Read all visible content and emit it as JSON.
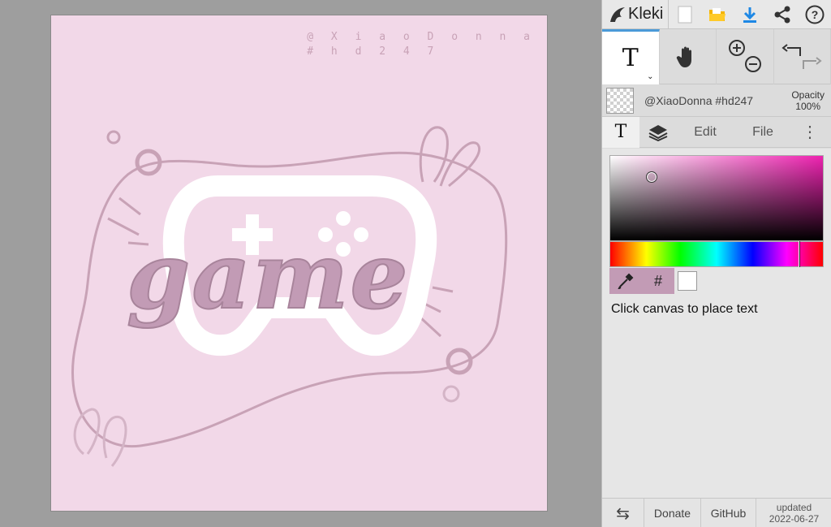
{
  "canvas": {
    "background_color": "#f2d8e8",
    "watermark_line1": "@ X i a o D o n n a",
    "watermark_line2": "# h d 2 4 7",
    "art_word": "game"
  },
  "app": {
    "logo_text": "Kleki",
    "top_icons": [
      "new-image-icon",
      "open-folder-icon",
      "download-icon",
      "share-icon",
      "help-icon"
    ]
  },
  "tools": {
    "text_tool_glyph": "T",
    "text_tool_caret": "⌄",
    "tool_icons": [
      "text-tool-icon",
      "hand-tool-icon",
      "zoom-in-icon",
      "zoom-out-icon",
      "undo-icon",
      "redo-icon"
    ]
  },
  "layer": {
    "name": "@XiaoDonna #hd247",
    "opacity_label": "Opacity",
    "opacity_value": "100%"
  },
  "tabs": {
    "text_tab": "T",
    "edit": "Edit",
    "file": "File",
    "more": "⋮"
  },
  "color_picker": {
    "hue_color": "#ee22b0",
    "hex_label": "#",
    "selected_color": "#ffffff",
    "accent": "#c29bb5"
  },
  "hint": "Click canvas to place text",
  "bottom": {
    "swap": "⇆",
    "donate": "Donate",
    "github": "GitHub",
    "updated_label": "updated",
    "updated_date": "2022-06-27"
  }
}
